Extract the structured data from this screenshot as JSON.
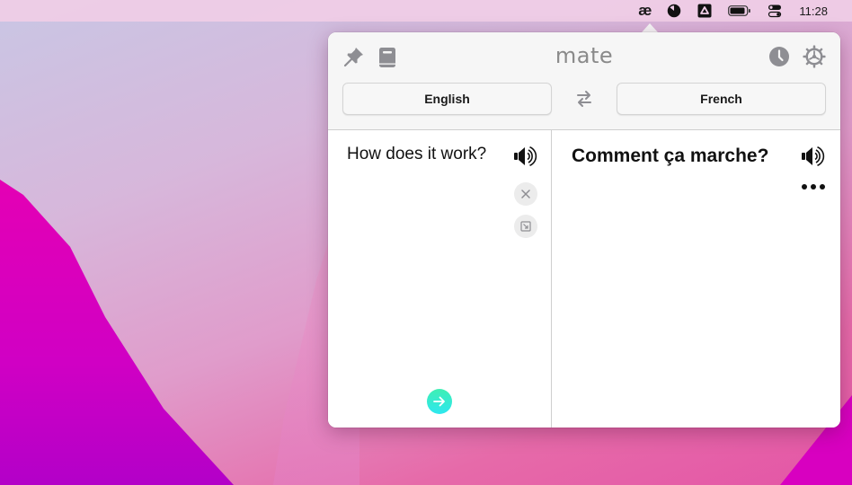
{
  "menubar": {
    "items": [
      {
        "name": "mate-menu-icon",
        "glyph": "æ"
      },
      {
        "name": "appearance-icon"
      },
      {
        "name": "drive-icon"
      },
      {
        "name": "battery-icon"
      },
      {
        "name": "control-center-icon"
      }
    ],
    "clock": "11:28"
  },
  "app": {
    "title": "mate",
    "header_icons": [
      "pin-icon",
      "book-icon",
      "history-icon",
      "gear-icon"
    ],
    "source_language": "English",
    "target_language": "French",
    "swap_icon": "swap-arrows-icon"
  },
  "source": {
    "text": "How does it work?",
    "actions": [
      "speaker-icon",
      "clear-icon",
      "paste-icon"
    ],
    "submit_icon": "arrow-right-icon"
  },
  "target": {
    "text": "Comment ça marche?",
    "actions": [
      "speaker-icon",
      "more-icon"
    ]
  },
  "colors": {
    "accent_start": "#3fefb3",
    "accent_end": "#2ee7ef",
    "title_gray": "#8a8a8a",
    "icon_gray": "#8e8e93"
  }
}
